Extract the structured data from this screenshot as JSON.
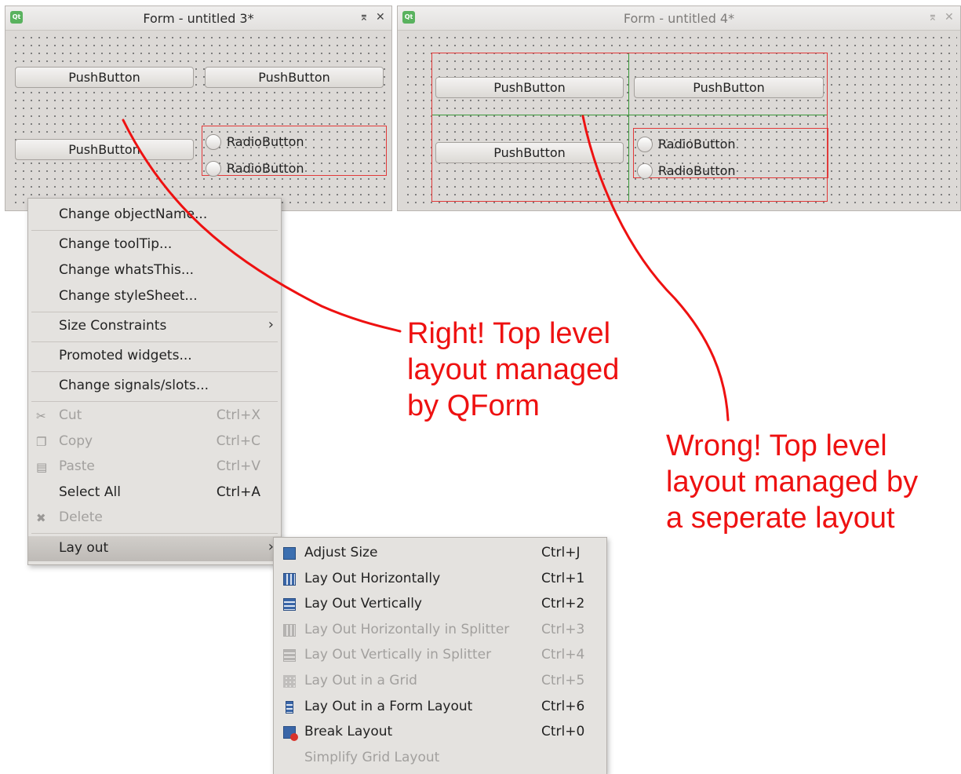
{
  "window1": {
    "title": "Form - untitled 3*",
    "btn_min": "⌆",
    "btn_close": "✕",
    "buttons": [
      "PushButton",
      "PushButton",
      "PushButton"
    ],
    "radios": [
      "RadioButton",
      "RadioButton"
    ]
  },
  "window2": {
    "title": "Form - untitled 4*",
    "btn_min": "⌆",
    "btn_close": "✕",
    "buttons": [
      "PushButton",
      "PushButton",
      "PushButton"
    ],
    "radios": [
      "RadioButton",
      "RadioButton"
    ]
  },
  "context_menu": {
    "items": [
      {
        "label": "Change objectName...",
        "shortcut": ""
      },
      {
        "label": "Change toolTip...",
        "shortcut": ""
      },
      {
        "label": "Change whatsThis...",
        "shortcut": ""
      },
      {
        "label": "Change styleSheet...",
        "shortcut": ""
      },
      {
        "label": "Size Constraints",
        "shortcut": ""
      },
      {
        "label": "Promoted widgets...",
        "shortcut": ""
      },
      {
        "label": "Change signals/slots...",
        "shortcut": ""
      },
      {
        "label": "Cut",
        "shortcut": "Ctrl+X"
      },
      {
        "label": "Copy",
        "shortcut": "Ctrl+C"
      },
      {
        "label": "Paste",
        "shortcut": "Ctrl+V"
      },
      {
        "label": "Select All",
        "shortcut": "Ctrl+A"
      },
      {
        "label": "Delete",
        "shortcut": ""
      },
      {
        "label": "Lay out",
        "shortcut": ""
      }
    ],
    "submenu_arrow": "›"
  },
  "layout_submenu": {
    "items": [
      {
        "label": "Adjust Size",
        "shortcut": "Ctrl+J"
      },
      {
        "label": "Lay Out Horizontally",
        "shortcut": "Ctrl+1"
      },
      {
        "label": "Lay Out Vertically",
        "shortcut": "Ctrl+2"
      },
      {
        "label": "Lay Out Horizontally in Splitter",
        "shortcut": "Ctrl+3"
      },
      {
        "label": "Lay Out Vertically in Splitter",
        "shortcut": "Ctrl+4"
      },
      {
        "label": "Lay Out in a Grid",
        "shortcut": "Ctrl+5"
      },
      {
        "label": "Lay Out in a Form Layout",
        "shortcut": "Ctrl+6"
      },
      {
        "label": "Break Layout",
        "shortcut": "Ctrl+0"
      },
      {
        "label": "Simplify Grid Layout",
        "shortcut": ""
      }
    ]
  },
  "annotations": {
    "right": "Right! Top level\nlayout managed\nby QForm",
    "wrong": "Wrong! Top level\nlayout managed by\na seperate layout"
  },
  "colors": {
    "annotation": "#ee1111",
    "layout_box": "#e23a3a",
    "grid_line": "#3b9a3b"
  }
}
